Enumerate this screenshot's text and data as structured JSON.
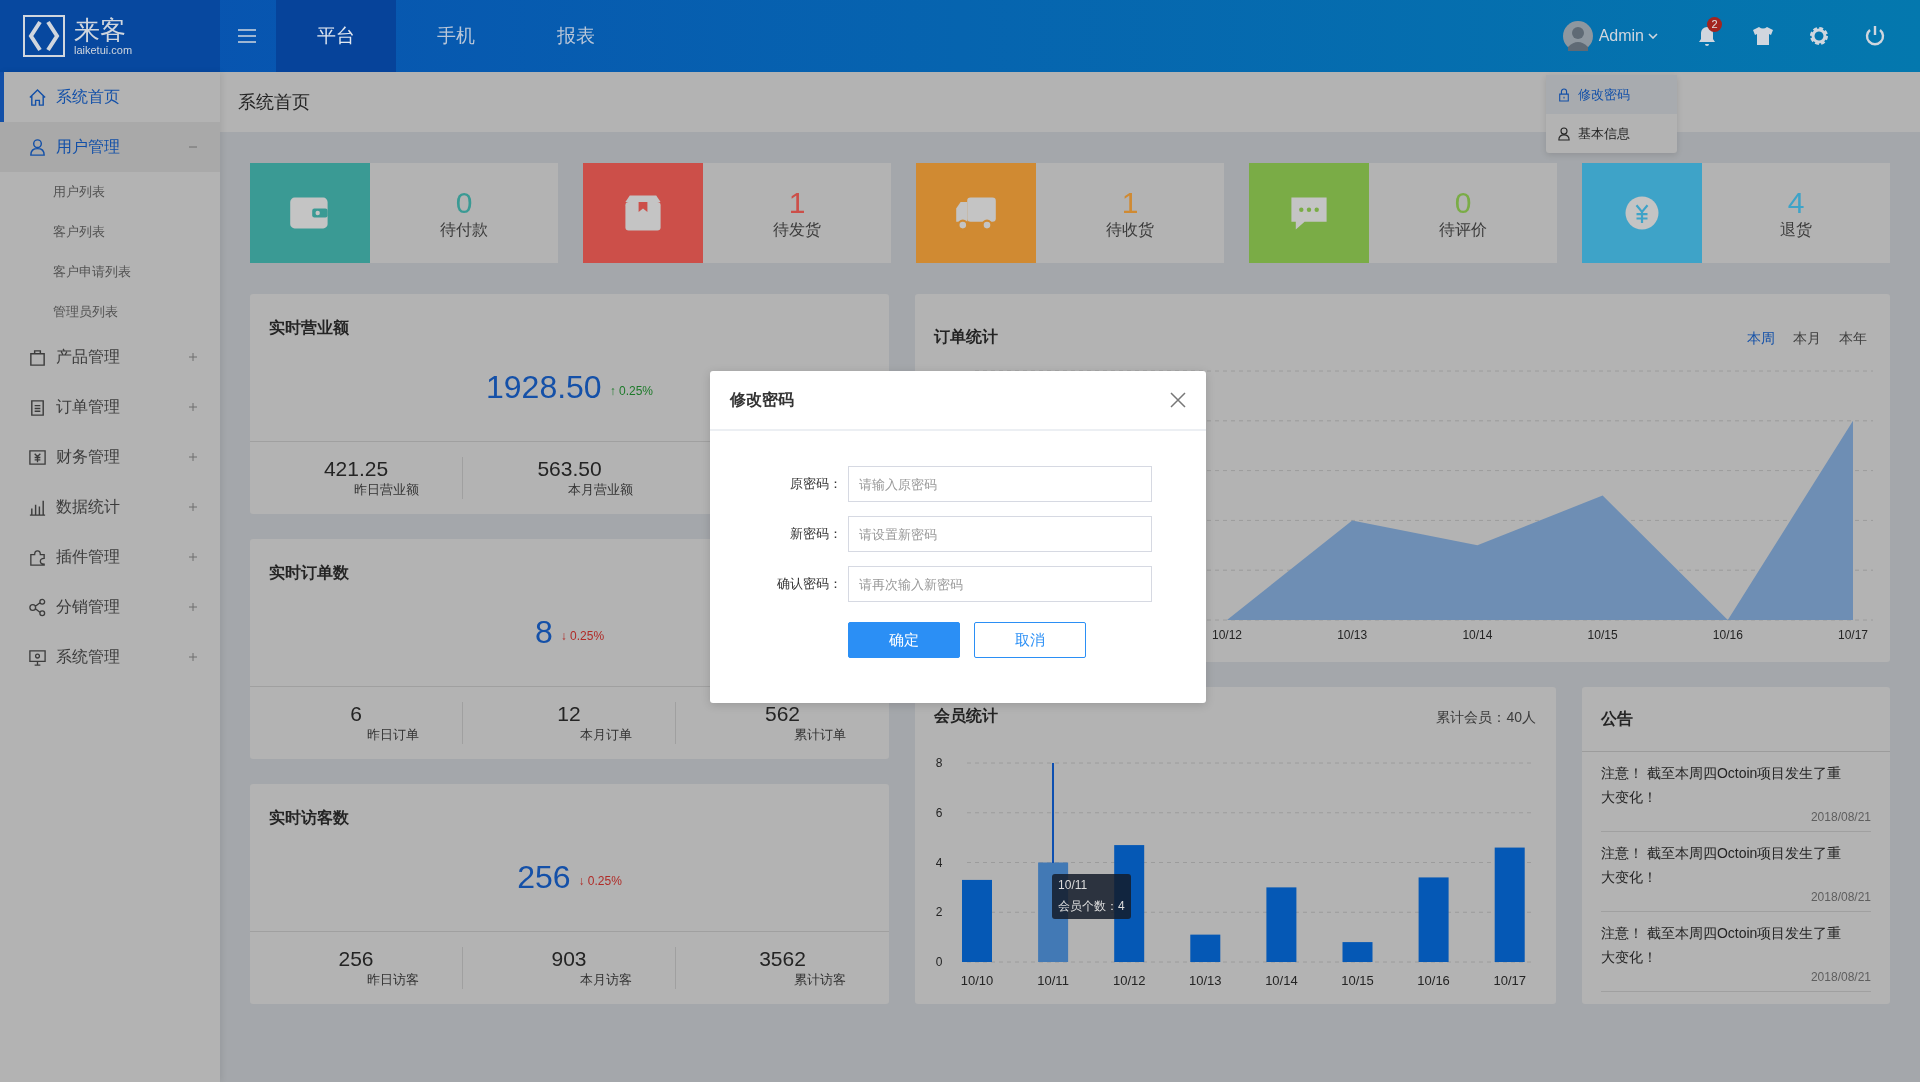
{
  "topbar": {
    "logo_title": "来客",
    "logo_subtitle": "laiketui.com",
    "tabs": [
      {
        "label": "平台",
        "selected": true
      },
      {
        "label": "手机",
        "selected": false
      },
      {
        "label": "报表",
        "selected": false
      }
    ],
    "user": {
      "name": "Admin"
    },
    "notification_count": "2"
  },
  "user_menu": [
    {
      "label": "修改密码",
      "selected": true
    },
    {
      "label": "基本信息",
      "selected": false
    }
  ],
  "sidebar": {
    "items": [
      {
        "label": "系统首页",
        "selected": true
      },
      {
        "label": "用户管理",
        "selected": false,
        "expanded": true,
        "children": [
          {
            "label": "用户列表"
          },
          {
            "label": "客户列表"
          },
          {
            "label": "客户申请列表"
          },
          {
            "label": "管理员列表"
          }
        ]
      },
      {
        "label": "产品管理",
        "selected": false,
        "expanded": false
      },
      {
        "label": "订单管理",
        "selected": false,
        "expanded": false
      },
      {
        "label": "财务管理",
        "selected": false,
        "expanded": false
      },
      {
        "label": "数据统计",
        "selected": false,
        "expanded": false
      },
      {
        "label": "插件管理",
        "selected": false,
        "expanded": false
      },
      {
        "label": "分销管理",
        "selected": false,
        "expanded": false
      },
      {
        "label": "系统管理",
        "selected": false,
        "expanded": false
      }
    ]
  },
  "breadcrumb": "系统首页",
  "stats": [
    {
      "value": "0",
      "label": "待付款",
      "color": "#3a9a94"
    },
    {
      "value": "1",
      "label": "待发货",
      "color": "#cc4f49"
    },
    {
      "value": "1",
      "label": "待收货",
      "color": "#d08a32"
    },
    {
      "value": "0",
      "label": "待评价",
      "color": "#7aac46"
    },
    {
      "value": "4",
      "label": "退货",
      "color": "#3ea3c8"
    }
  ],
  "realtime_cards": [
    {
      "title": "实时营业额",
      "value": "1928.50",
      "change": "↑ 0.25%",
      "rising": true,
      "metrics": [
        {
          "value": "421.25",
          "label": "昨日营业额"
        },
        {
          "value": "563.50",
          "label": "本月营业额"
        }
      ]
    },
    {
      "title": "实时订单数",
      "value": "8",
      "change": "↓ 0.25%",
      "rising": false,
      "metrics": [
        {
          "value": "6",
          "label": "昨日订单"
        },
        {
          "value": "12",
          "label": "本月订单"
        },
        {
          "value": "562",
          "label": "累计订单"
        }
      ]
    },
    {
      "title": "实时访客数",
      "value": "256",
      "change": "↓ 0.25%",
      "rising": false,
      "metrics": [
        {
          "value": "256",
          "label": "昨日访客"
        },
        {
          "value": "903",
          "label": "本月访客"
        },
        {
          "value": "3562",
          "label": "累计访客"
        }
      ]
    }
  ],
  "order_chart": {
    "title": "订单统计",
    "periods": [
      {
        "label": "本周",
        "selected": true
      },
      {
        "label": "本月",
        "selected": false
      },
      {
        "label": "本年",
        "selected": false
      }
    ],
    "x_labels": [
      "10/12",
      "10/13",
      "10/14",
      "10/15",
      "10/16",
      "10/17"
    ]
  },
  "member_chart": {
    "title": "会员统计",
    "total": "累计会员：40人",
    "chart_data": {
      "type": "bar",
      "categories": [
        "10/10",
        "10/11",
        "10/12",
        "10/13",
        "10/14",
        "10/15",
        "10/16",
        "10/17"
      ],
      "values": [
        3.3,
        4,
        4.7,
        1.1,
        3,
        0.8,
        3.4,
        4.6
      ],
      "ylim": [
        0,
        8
      ],
      "yticks": [
        {
          "value": 0,
          "label": "0"
        },
        {
          "value": 2,
          "label": "2"
        },
        {
          "value": 4,
          "label": "4"
        },
        {
          "value": 6,
          "label": "6"
        },
        {
          "value": 8,
          "label": "8"
        }
      ],
      "grid": true
    },
    "tooltip": {
      "title": "10/11",
      "text": "会员个数：4"
    }
  },
  "notices": {
    "title": "公告",
    "items": [
      {
        "text": "注意！ 截至本周四Octoin项目发生了重大变化！",
        "date": "2018/08/21"
      },
      {
        "text": "注意！ 截至本周四Octoin项目发生了重大变化！",
        "date": "2018/08/21"
      },
      {
        "text": "注意！ 截至本周四Octoin项目发生了重大变化！",
        "date": "2018/08/21"
      }
    ]
  },
  "modal": {
    "title": "修改密码",
    "fields": [
      {
        "label": "原密码：",
        "placeholder": "请输入原密码"
      },
      {
        "label": "新密码：",
        "placeholder": "请设置新密码"
      },
      {
        "label": "确认密码：",
        "placeholder": "请再次输入新密码"
      }
    ],
    "buttons": [
      {
        "label": "确定",
        "kind": "primary"
      },
      {
        "label": "取消",
        "kind": "secondary"
      }
    ]
  }
}
